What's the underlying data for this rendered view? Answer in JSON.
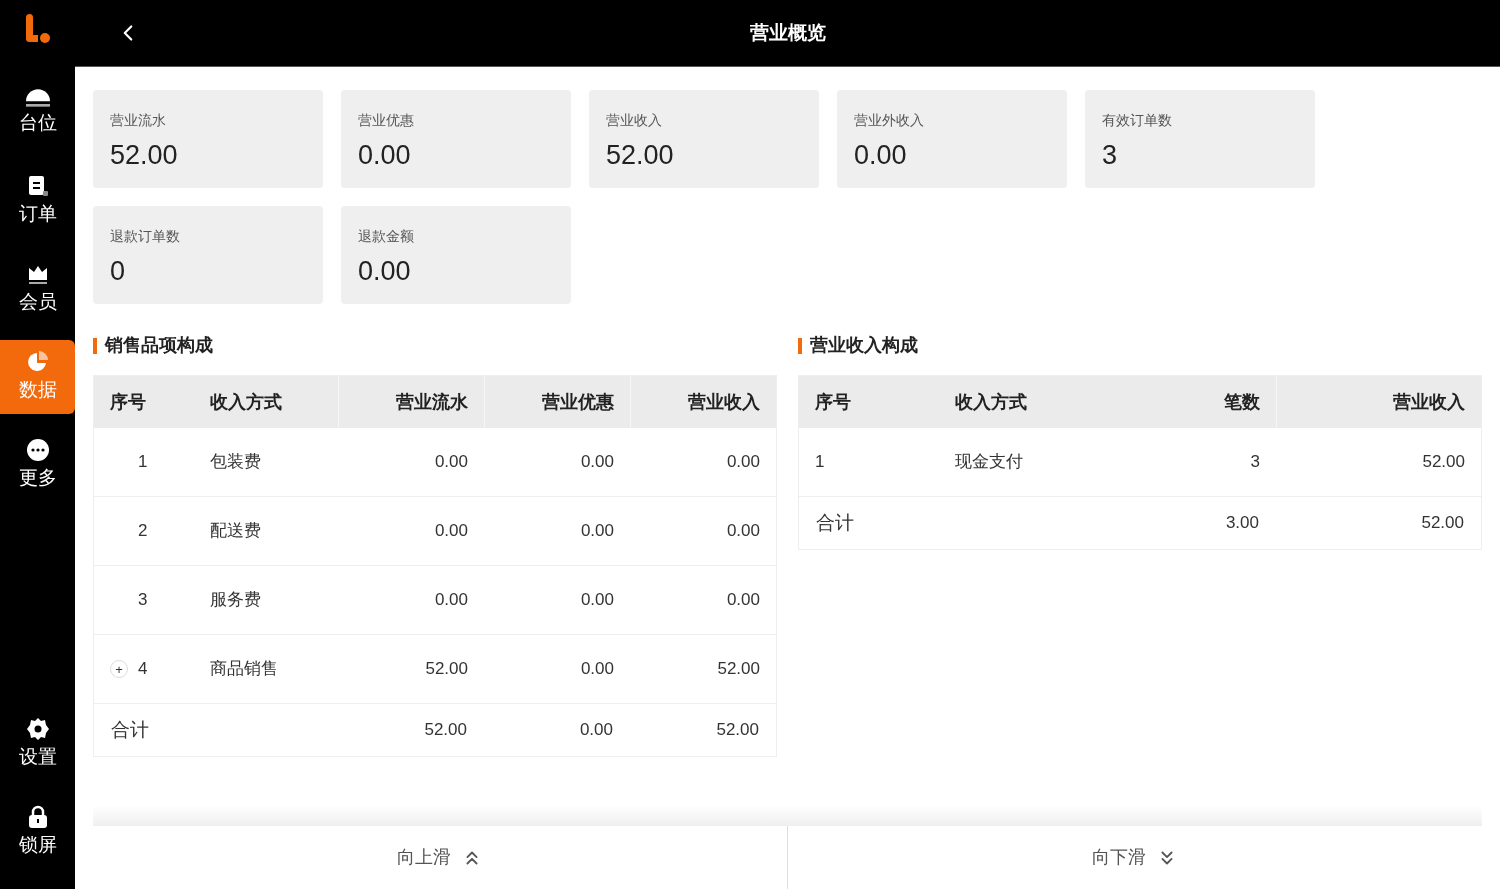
{
  "sidebar": {
    "items": [
      {
        "label": "台位",
        "selected": false
      },
      {
        "label": "订单",
        "selected": false
      },
      {
        "label": "会员",
        "selected": false
      },
      {
        "label": "数据",
        "selected": true
      },
      {
        "label": "更多",
        "selected": false
      }
    ],
    "footer_items": [
      {
        "label": "设置"
      },
      {
        "label": "锁屏"
      }
    ]
  },
  "header": {
    "title": "营业概览"
  },
  "stats": [
    {
      "label": "营业流水",
      "value": "52.00"
    },
    {
      "label": "营业优惠",
      "value": "0.00"
    },
    {
      "label": "营业收入",
      "value": "52.00"
    },
    {
      "label": "营业外收入",
      "value": "0.00"
    },
    {
      "label": "有效订单数",
      "value": "3"
    },
    {
      "label": "退款订单数",
      "value": "0"
    },
    {
      "label": "退款金额",
      "value": "0.00"
    }
  ],
  "sales_table": {
    "title": "销售品项构成",
    "columns": [
      "序号",
      "收入方式",
      "营业流水",
      "营业优惠",
      "营业收入"
    ],
    "rows": [
      {
        "kind": "plain",
        "cells": [
          "1",
          "包装费",
          "0.00",
          "0.00",
          "0.00"
        ]
      },
      {
        "kind": "plain",
        "cells": [
          "2",
          "配送费",
          "0.00",
          "0.00",
          "0.00"
        ]
      },
      {
        "kind": "plain",
        "cells": [
          "3",
          "服务费",
          "0.00",
          "0.00",
          "0.00"
        ]
      },
      {
        "kind": "expandable",
        "expand_symbol": "+",
        "cells": [
          "4",
          "商品销售",
          "52.00",
          "0.00",
          "52.00"
        ]
      }
    ],
    "total": [
      "合计",
      "52.00",
      "0.00",
      "52.00"
    ]
  },
  "income_table": {
    "title": "营业收入构成",
    "columns": [
      "序号",
      "收入方式",
      "笔数",
      "营业收入"
    ],
    "rows": [
      {
        "cells": [
          "1",
          "现金支付",
          "3",
          "52.00"
        ]
      }
    ],
    "total": [
      "合计",
      "3.00",
      "52.00"
    ]
  },
  "footer": {
    "buttons": [
      {
        "label": "向上滑",
        "kind": "up"
      },
      {
        "label": "向下滑",
        "kind": "down"
      }
    ]
  }
}
